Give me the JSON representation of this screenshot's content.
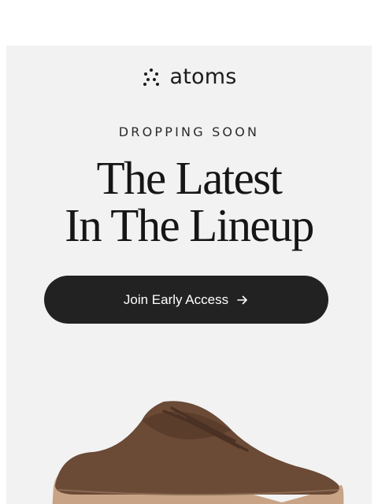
{
  "brand": {
    "name": "atoms",
    "logo_icon": "dots-cluster-icon"
  },
  "hero": {
    "eyebrow": "DROPPING SOON",
    "headline_line1": "The Latest",
    "headline_line2": "In The Lineup"
  },
  "cta": {
    "label": "Join Early Access",
    "icon": "arrow-right-icon"
  },
  "product": {
    "image": "brown-knit-sneaker"
  },
  "colors": {
    "card_bg": "#f2f2f2",
    "button_bg": "#222222",
    "shoe_upper": "#6b4a36",
    "shoe_sole": "#c8a386"
  }
}
